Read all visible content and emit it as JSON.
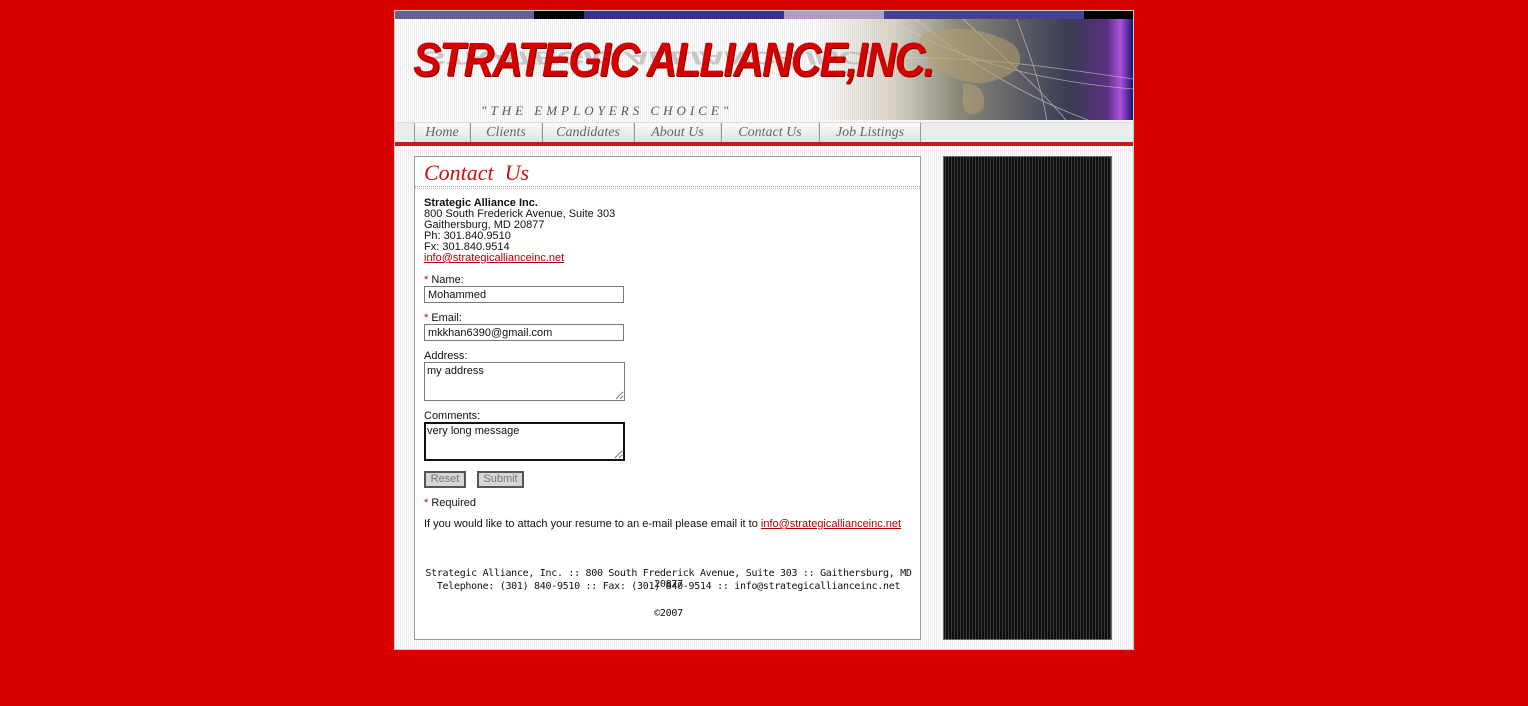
{
  "header": {
    "logo_text": "STRATEGIC ALLIANCE,INC.",
    "tagline": "\"THE EMPLOYERS CHOICE\"",
    "color_bar": [
      "#6a5f92",
      "#000000",
      "#3d2f8f",
      "#b39bc2",
      "#4a3e8e",
      "#000000"
    ]
  },
  "nav": {
    "items": [
      {
        "label": "Home"
      },
      {
        "label": "Clients"
      },
      {
        "label": "Candidates"
      },
      {
        "label": "About Us"
      },
      {
        "label": "Contact Us"
      },
      {
        "label": "Job Listings"
      }
    ]
  },
  "contact": {
    "title": "Contact  Us",
    "company": "Strategic Alliance Inc.",
    "street": "800 South Frederick Avenue, Suite 303",
    "city": "Gaithersburg, MD 20877",
    "phone": "Ph: 301.840.9510",
    "fax": "Fx: 301.840.9514",
    "email": "info@strategicallianceinc.net"
  },
  "form": {
    "required_mark": "*",
    "name_label": "Name:",
    "name_value": "Mohammed",
    "email_label": "Email:",
    "email_value": "mkkhan6390@gmail.com",
    "address_label": "Address:",
    "address_value": "my address",
    "comments_label": "Comments:",
    "comments_value": "very long message",
    "reset_label": "Reset",
    "submit_label": "Submit",
    "required_note": "Required",
    "attach_note": "If you would like to attach your resume to an e-mail please email it to",
    "attach_email": "info@strategicallianceinc.net"
  },
  "footer": {
    "line1": "Strategic Alliance, Inc.  ::  800 South Frederick Avenue, Suite 303  ::  Gaithersburg, MD 20877",
    "line2": "Telephone: (301) 840-9510  ::  Fax: (301) 840-9514  ::  info@strategicallianceinc.net",
    "copyright": "©2007"
  }
}
